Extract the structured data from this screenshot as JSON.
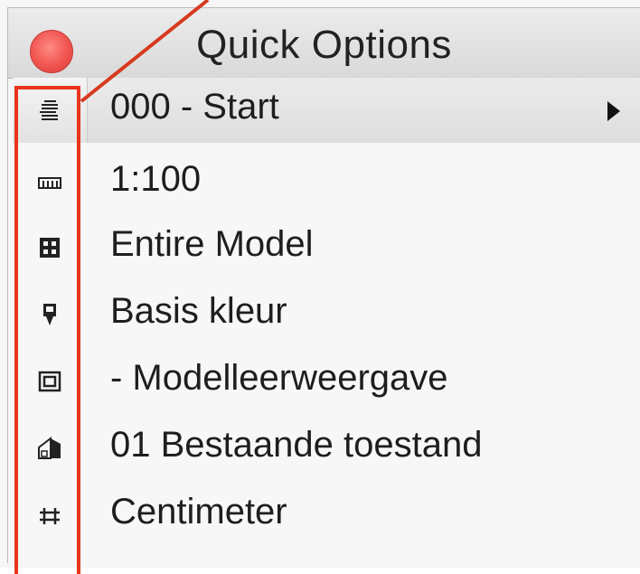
{
  "window": {
    "title": "Quick Options"
  },
  "options": [
    {
      "label": "000 - Start",
      "icon": "layers-icon",
      "has_submenu": true,
      "selected": true
    },
    {
      "label": "1:100",
      "icon": "scale-ruler-icon",
      "has_submenu": false,
      "selected": false
    },
    {
      "label": "Entire Model",
      "icon": "model-view-icon",
      "has_submenu": false,
      "selected": false
    },
    {
      "label": "Basis kleur",
      "icon": "pen-set-icon",
      "has_submenu": false,
      "selected": false
    },
    {
      "label": "- Modelleerweergave",
      "icon": "display-option-icon",
      "has_submenu": false,
      "selected": false
    },
    {
      "label": "01 Bestaande toestand",
      "icon": "renovation-filter-icon",
      "has_submenu": false,
      "selected": false
    },
    {
      "label": "Centimeter",
      "icon": "dimension-icon",
      "has_submenu": false,
      "selected": false
    }
  ],
  "annotation": {
    "color": "#e8341c"
  }
}
